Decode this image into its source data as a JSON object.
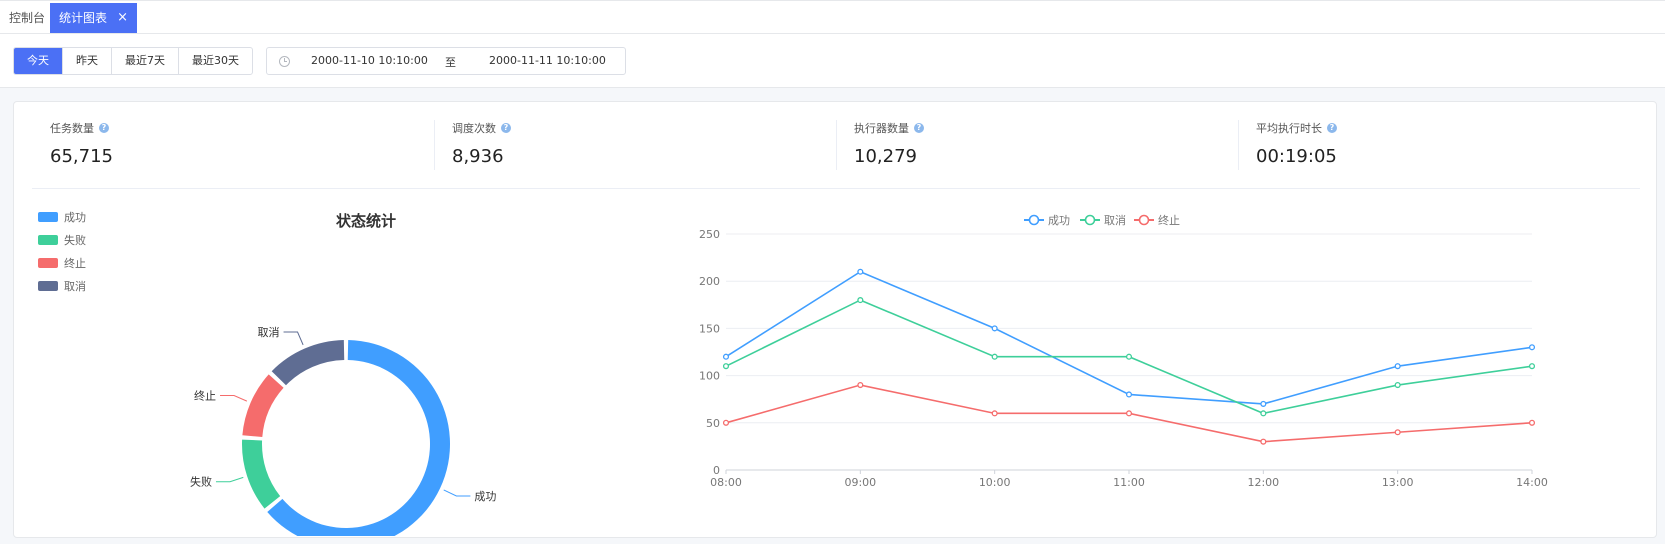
{
  "tabs": {
    "console_label": "控制台",
    "active_label": "统计图表",
    "close_glyph": "×"
  },
  "toolbar": {
    "range_buttons": [
      "今天",
      "昨天",
      "最近7天",
      "最近30天"
    ],
    "date_start": "2000-11-10 10:10:00",
    "date_separator": "至",
    "date_end": "2000-11-11 10:10:00"
  },
  "stats": [
    {
      "label": "任务数量",
      "value": "65,715"
    },
    {
      "label": "调度次数",
      "value": "8,936"
    },
    {
      "label": "执行器数量",
      "value": "10,279"
    },
    {
      "label": "平均执行时长",
      "value": "00:19:05"
    }
  ],
  "help_glyph": "?",
  "colors": {
    "accent": "#4b70f5",
    "success": "#409eff",
    "failed": "#3ecf9a",
    "terminated": "#f56c6c",
    "cancelled": "#5f6d93",
    "cancel_line": "#3ecf9a"
  },
  "chart_data": [
    {
      "type": "pie",
      "title": "状态统计",
      "legend": [
        "成功",
        "失败",
        "终止",
        "取消"
      ],
      "legend_placement": "top-left",
      "slices": [
        {
          "name": "成功",
          "value": 64
        },
        {
          "name": "失败",
          "value": 12
        },
        {
          "name": "终止",
          "value": 11
        },
        {
          "name": "取消",
          "value": 13
        }
      ],
      "slice_label_order": [
        "取消",
        "终止",
        "失败",
        "成功"
      ]
    },
    {
      "type": "line",
      "legend": [
        "成功",
        "取消",
        "终止"
      ],
      "legend_placement": "top-center",
      "categories": [
        "08:00",
        "09:00",
        "10:00",
        "11:00",
        "12:00",
        "13:00",
        "14:00"
      ],
      "series": [
        {
          "name": "成功",
          "values": [
            120,
            210,
            150,
            80,
            70,
            110,
            130
          ]
        },
        {
          "name": "取消",
          "values": [
            110,
            180,
            120,
            120,
            60,
            90,
            110
          ]
        },
        {
          "name": "终止",
          "values": [
            50,
            90,
            60,
            60,
            30,
            40,
            50
          ]
        }
      ],
      "ylim": [
        0,
        250
      ],
      "yticks": [
        0,
        50,
        100,
        150,
        200,
        250
      ],
      "grid": true
    }
  ]
}
